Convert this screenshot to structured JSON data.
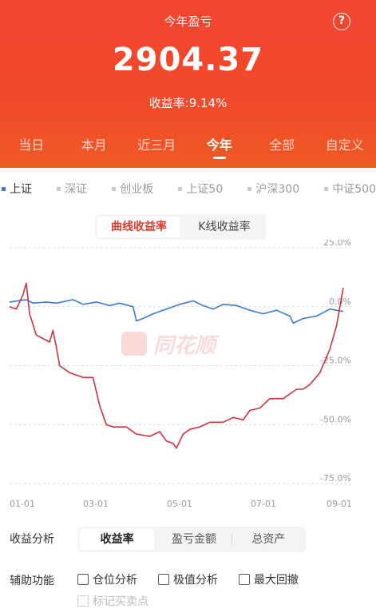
{
  "header": {
    "title": "今年盈亏",
    "help_icon": "?",
    "amount": "2904.37",
    "rate": "收益率:9.14%",
    "tabs": [
      "当日",
      "本月",
      "近三月",
      "今年",
      "全部",
      "自定义"
    ],
    "active_tab": "今年"
  },
  "indexes": [
    "上证",
    "深证",
    "创业板",
    "上证50",
    "沪深300",
    "中证500"
  ],
  "active_index": "上证",
  "chart_toggle": {
    "options": [
      "曲线收益率",
      "K线收益率"
    ],
    "active": "曲线收益率"
  },
  "watermark": "同花顺",
  "chart_data": {
    "type": "line",
    "x_ticks": [
      "01-01",
      "03-01",
      "05-01",
      "07-01",
      "09-01"
    ],
    "y_ticks": [
      "25.0%",
      "0.0%",
      "-25.0%",
      "-50.0%",
      "-75.0%"
    ],
    "ylim": [
      -75,
      25
    ],
    "grid": true,
    "series": [
      {
        "color": "#3b7ad8",
        "x": [
          0,
          0.05,
          0.07,
          0.11,
          0.14,
          0.19,
          0.22,
          0.26,
          0.3,
          0.33,
          0.37,
          0.38,
          0.4,
          0.43,
          0.47,
          0.51,
          0.55,
          0.58,
          0.61,
          0.64,
          0.68,
          0.72,
          0.76,
          0.8,
          0.84,
          0.85,
          0.88,
          0.92,
          0.96,
          1.0
        ],
        "y": [
          2,
          3,
          1.5,
          2,
          1.5,
          3,
          1,
          2,
          0.5,
          1.5,
          0,
          -6,
          -5,
          -3,
          -1,
          1,
          2.5,
          0.5,
          -1,
          1,
          0.5,
          -1.5,
          -3,
          -1.5,
          -4,
          -7,
          -5,
          -4,
          -1,
          -2
        ]
      },
      {
        "color": "#d23240",
        "x": [
          0,
          0.02,
          0.04,
          0.05,
          0.06,
          0.08,
          0.12,
          0.13,
          0.14,
          0.15,
          0.18,
          0.22,
          0.25,
          0.27,
          0.29,
          0.31,
          0.35,
          0.38,
          0.42,
          0.45,
          0.47,
          0.49,
          0.5,
          0.52,
          0.54,
          0.57,
          0.6,
          0.64,
          0.67,
          0.7,
          0.72,
          0.75,
          0.78,
          0.82,
          0.84,
          0.86,
          0.88,
          0.9,
          0.93,
          0.96,
          0.98,
          1.0
        ],
        "y": [
          0,
          -1,
          5,
          10,
          -3,
          -12,
          -15,
          -10,
          -17,
          -25,
          -28,
          -30,
          -30,
          -42,
          -50,
          -51,
          -51,
          -54,
          -55,
          -53,
          -57,
          -58,
          -60,
          -54,
          -52,
          -51,
          -49,
          -49,
          -47,
          -48,
          -44,
          -43,
          -39,
          -39,
          -37,
          -35,
          -35,
          -33,
          -28,
          -18,
          -8,
          8
        ]
      }
    ]
  },
  "analysis": {
    "label": "收益分析",
    "options": [
      "收益率",
      "盈亏金额",
      "总资产"
    ],
    "active": "收益率"
  },
  "aux": {
    "label": "辅助功能",
    "checks": [
      "仓位分析",
      "极值分析",
      "最大回撤"
    ],
    "disabled_check": "标记买卖点"
  }
}
